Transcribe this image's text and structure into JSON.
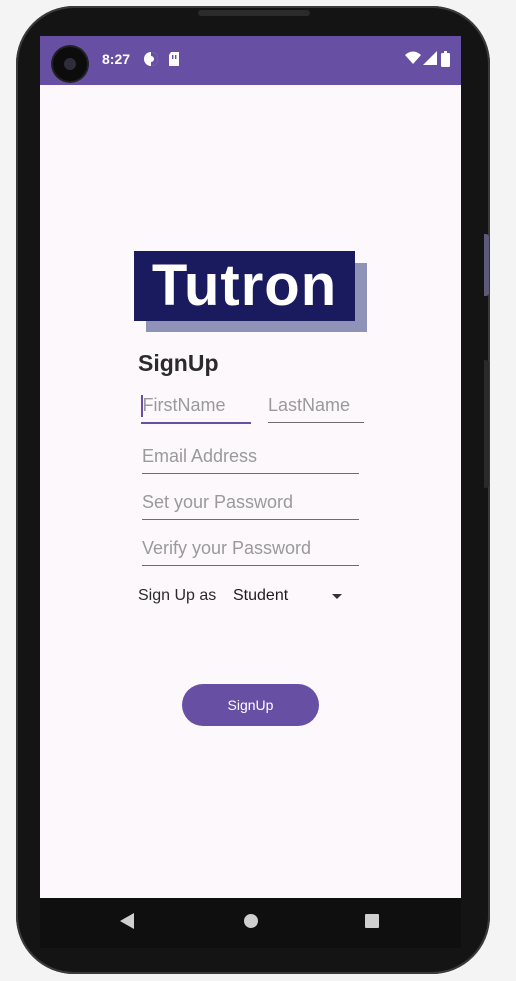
{
  "status_bar": {
    "time": "8:27",
    "icons": [
      "data-saver-icon",
      "sim-card-icon",
      "wifi-icon",
      "signal-icon",
      "battery-icon"
    ]
  },
  "logo": {
    "text": "Tutron"
  },
  "form": {
    "heading": "SignUp",
    "first_name": {
      "placeholder": "FirstName",
      "value": ""
    },
    "last_name": {
      "placeholder": "LastName",
      "value": ""
    },
    "email": {
      "placeholder": "Email Address",
      "value": ""
    },
    "password": {
      "placeholder": "Set your Password",
      "value": ""
    },
    "verify_password": {
      "placeholder": "Verify your Password",
      "value": ""
    },
    "signup_as_label": "Sign Up as",
    "role": {
      "selected": "Student"
    },
    "submit_label": "SignUp"
  },
  "nav": {
    "icons": [
      "back-icon",
      "home-icon",
      "recents-icon"
    ]
  },
  "colors": {
    "primary": "#6750a4",
    "logo_bg": "#1a1b5e",
    "logo_shadow": "#8f93b8",
    "screen_bg": "#fdf8fc"
  }
}
